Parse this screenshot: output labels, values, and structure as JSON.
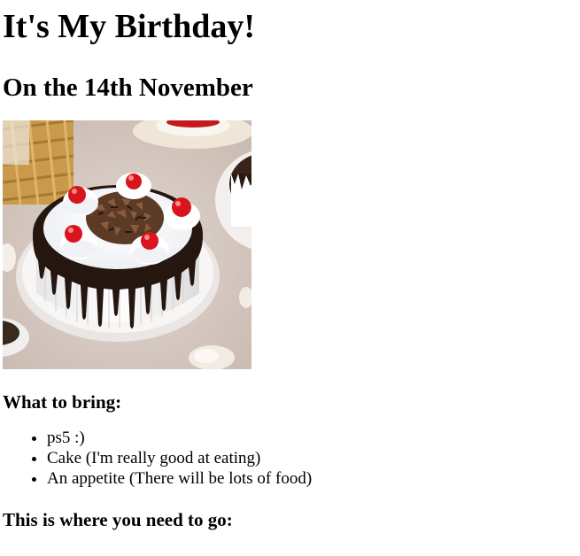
{
  "heading": "It's My Birthday!",
  "subheading": "On the 14th November",
  "image": {
    "icon": "birthday-cake-photo",
    "colors": {
      "background": "#d8ccc4",
      "plate": "#f3f0ee",
      "cream": "#ffffff",
      "chocolate": "#2a1a14",
      "cherry": "#d8141e",
      "basket": "#c99a4c"
    }
  },
  "bring": {
    "title": "What to bring:",
    "items": [
      "ps5 :)",
      "Cake (I'm really good at eating)",
      "An appetite (There will be lots of food)"
    ]
  },
  "directions": {
    "title": "This is where you need to go:"
  }
}
